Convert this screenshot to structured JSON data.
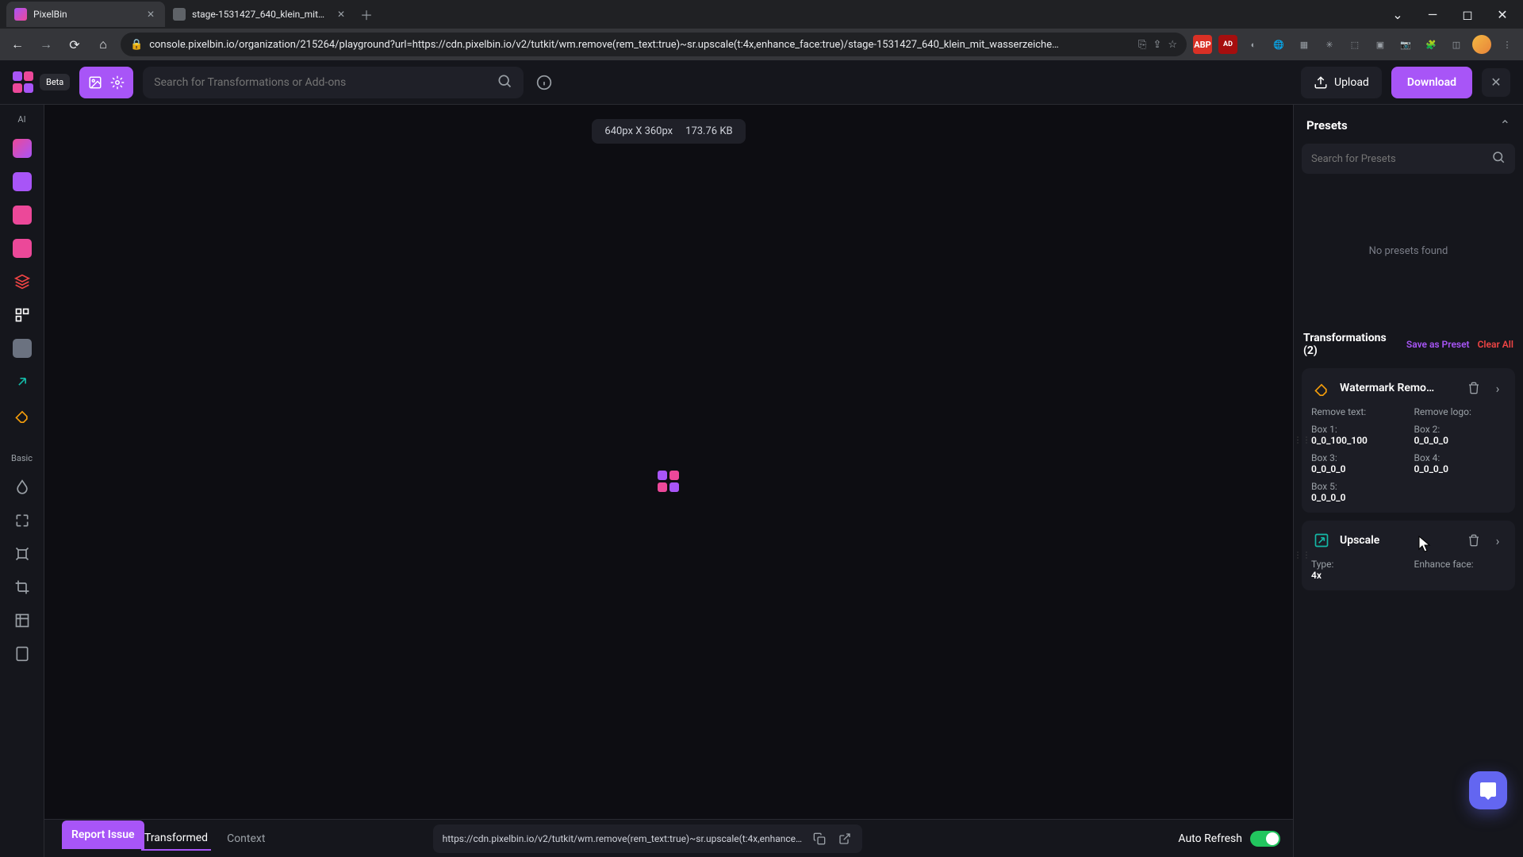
{
  "browser": {
    "tabs": [
      {
        "title": "PixelBin",
        "active": true
      },
      {
        "title": "stage-1531427_640_klein_mit_w…",
        "active": false
      }
    ],
    "url": "console.pixelbin.io/organization/215264/playground?url=https://cdn.pixelbin.io/v2/tutkit/wm.remove(rem_text:true)~sr.upscale(t:4x,enhance_face:true)/stage-1531427_640_klein_mit_wasserzeiche…"
  },
  "appbar": {
    "beta": "Beta",
    "search_placeholder": "Search for Transformations or Add-ons",
    "upload": "Upload",
    "download": "Download"
  },
  "canvas": {
    "dimensions": "640px X 360px",
    "filesize": "173.76 KB"
  },
  "leftrail": {
    "heading_ai": "AI",
    "heading_basic": "Basic"
  },
  "bottom": {
    "tabs": {
      "transformed": "Transformed",
      "context": "Context"
    },
    "url_preview": "https://cdn.pixelbin.io/v2/tutkit/wm.remove(rem_text:true)~sr.upscale(t:4x,enhance…",
    "auto_refresh": "Auto Refresh",
    "report_issue": "Report Issue"
  },
  "presets": {
    "title": "Presets",
    "search_placeholder": "Search for Presets",
    "empty": "No presets found"
  },
  "transformations": {
    "title": "Transformations (2)",
    "save_as_preset": "Save as Preset",
    "clear_all": "Clear All",
    "items": [
      {
        "name": "Watermark Remo…",
        "props": [
          {
            "label": "Remove text:",
            "value": ""
          },
          {
            "label": "Remove logo:",
            "value": ""
          },
          {
            "label": "Box 1:",
            "value": "0_0_100_100"
          },
          {
            "label": "Box 2:",
            "value": "0_0_0_0"
          },
          {
            "label": "Box 3:",
            "value": "0_0_0_0"
          },
          {
            "label": "Box 4:",
            "value": "0_0_0_0"
          },
          {
            "label": "Box 5:",
            "value": "0_0_0_0"
          }
        ]
      },
      {
        "name": "Upscale",
        "props": [
          {
            "label": "Type:",
            "value": "4x"
          },
          {
            "label": "Enhance face:",
            "value": ""
          }
        ]
      }
    ]
  },
  "colors": {
    "accent": "#a855f7",
    "pink": "#ec4899",
    "teal": "#14b8a6"
  }
}
